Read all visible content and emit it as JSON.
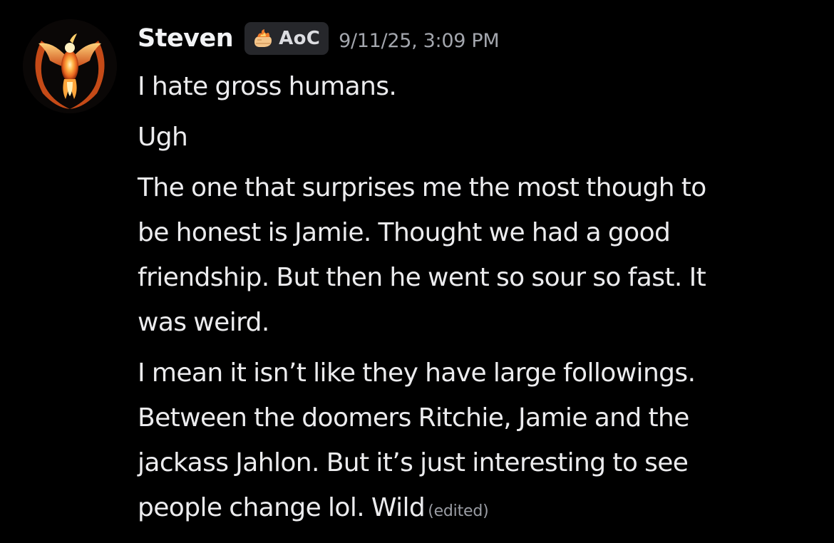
{
  "author": {
    "username": "Steven",
    "avatar_icon": "phoenix-icon",
    "tag": {
      "icon": "flame-hand-icon",
      "label": "AoC"
    }
  },
  "timestamp": "9/11/25, 3:09 PM",
  "messages": [
    {
      "text": "I hate gross humans."
    },
    {
      "text": "Ugh"
    },
    {
      "text": "The one that surprises me the most though to\nbe honest is Jamie. Thought we had a good\nfriendship. But then he went so sour so fast. It\nwas weird."
    },
    {
      "text": "I mean it isn’t like they have large followings.\nBetween the doomers Ritchie, Jamie and the\njackass Jahlon. But it’s just interesting to see\npeople change lol. Wild",
      "edited_label": "(edited)"
    }
  ],
  "colors": {
    "background": "#000000",
    "username": "#f2f3f5",
    "message_text": "#ececee",
    "timestamp": "#a3a6ad",
    "tag_background": "#26272b",
    "avatar_accent": "#e8641e"
  }
}
